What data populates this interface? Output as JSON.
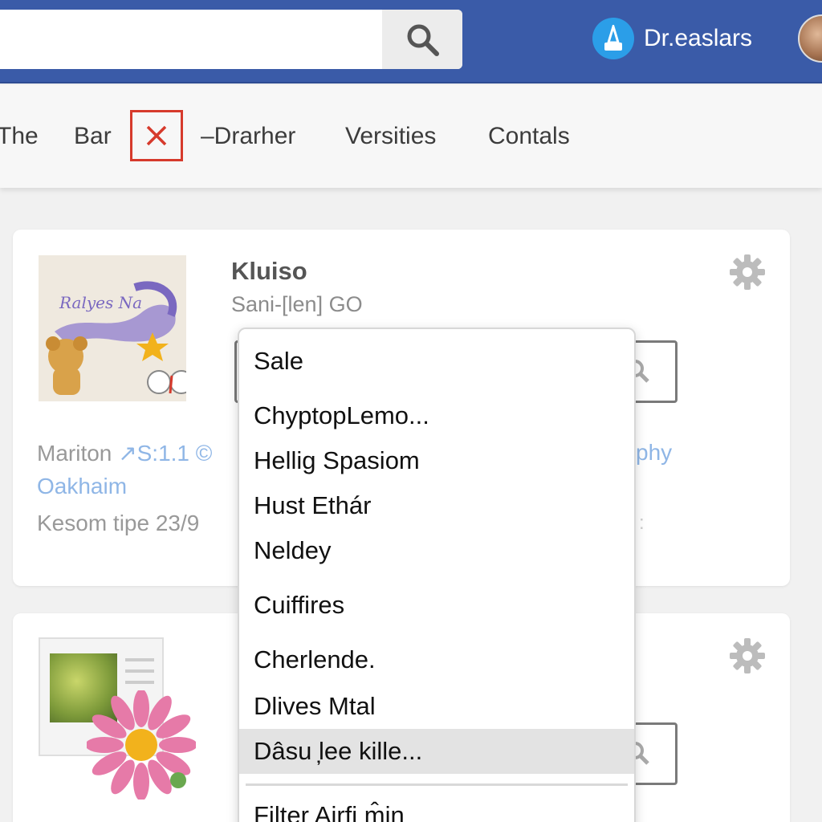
{
  "topbar": {
    "search_value": "",
    "account_name": "Dr.easlars",
    "icons": [
      "search-icon",
      "account-icon",
      "avatar"
    ]
  },
  "tabs": [
    {
      "label": "The"
    },
    {
      "label": "Bar"
    },
    {
      "label": "–Drarher"
    },
    {
      "label": "Versities"
    },
    {
      "label": "Contals"
    }
  ],
  "card1": {
    "thumbnail_text": "Ralyes Na",
    "title": "Kluiso",
    "subtitle": "Sani-[len] GO",
    "meta_1_prefix": "Mariton",
    "meta_1_link": "↗S:1.1 ©",
    "meta_link_right": "phy",
    "meta_2": "Oakhaim",
    "meta_3": "Kesom tipe 23/9"
  },
  "dropdown": {
    "items": [
      {
        "label": "Sale"
      },
      {
        "label": "ChyptopLemo..."
      },
      {
        "label": "Hellig Spasiom"
      },
      {
        "label": "Hust Ethár"
      },
      {
        "label": "Neldey"
      },
      {
        "label": "Cuiffires"
      },
      {
        "label": "Cherlende."
      },
      {
        "label": "Dlives Mtal"
      },
      {
        "label": "Dâsu ̦lee kille..."
      },
      {
        "label": "Filter Airfi m̂in"
      }
    ],
    "active_index": 8
  },
  "colors": {
    "topbar": "#3a5ba8",
    "close_border": "#d63a2c",
    "link": "#8fb6e6"
  }
}
